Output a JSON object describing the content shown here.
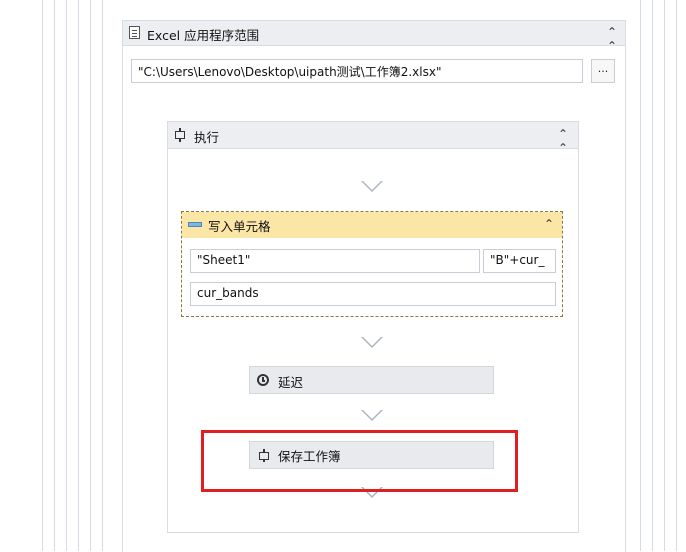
{
  "excel_scope": {
    "title": "Excel 应用程序范围",
    "collapse_icon": "double-chevron-up-icon",
    "workbook_path": "\"C:\\Users\\Lenovo\\Desktop\\uipath测试\\工作簿2.xlsx\"",
    "browse_label": "..."
  },
  "execute": {
    "title": "执行",
    "collapse_icon": "double-chevron-up-icon"
  },
  "write_cell": {
    "title": "写入单元格",
    "sheet_value": "\"Sheet1\"",
    "range_value": "\"B\"+cur_",
    "value_field": "cur_bands",
    "collapse_icon": "double-chevron-up-icon"
  },
  "delay": {
    "title": "延迟",
    "icon": "clock-icon"
  },
  "save_workbook": {
    "title": "保存工作簿",
    "icon": "save-workbook-icon"
  },
  "colors": {
    "highlight": "#e02020",
    "write_header": "#fbe6a6",
    "header_bg": "#eceef1"
  }
}
